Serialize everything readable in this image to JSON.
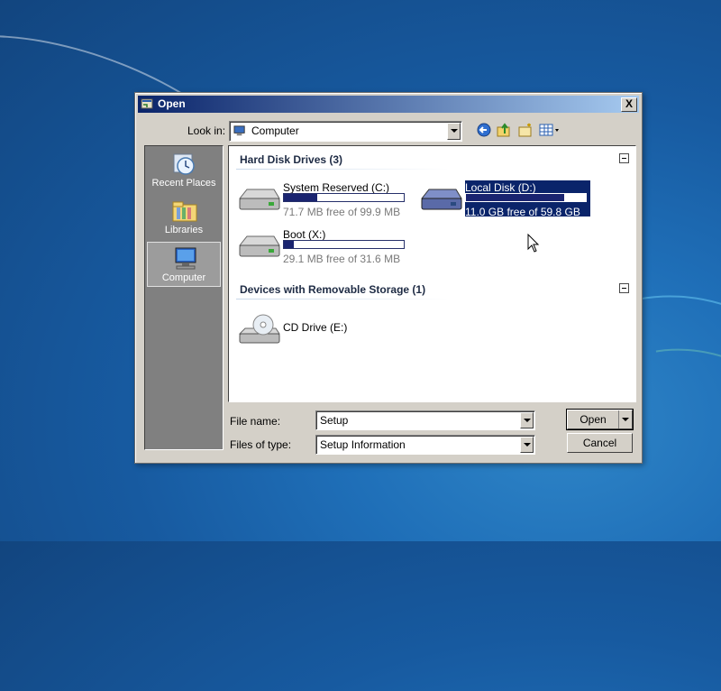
{
  "dialog": {
    "title": "Open",
    "close_label": "X"
  },
  "look_in": {
    "label": "Look in:",
    "value": "Computer"
  },
  "places": [
    {
      "label": "Recent Places",
      "icon": "recent-places-icon"
    },
    {
      "label": "Libraries",
      "icon": "libraries-icon"
    },
    {
      "label": "Computer",
      "icon": "computer-icon",
      "selected": true
    }
  ],
  "groups": {
    "hard_disks": {
      "header": "Hard Disk Drives (3)",
      "drives": [
        {
          "name": "System Reserved (C:)",
          "free": "71.7 MB free of 99.9 MB",
          "used_fraction": 0.28
        },
        {
          "name": "Local Disk (D:)",
          "free": "11.0 GB free of 59.8 GB",
          "used_fraction": 0.82,
          "selected": true
        },
        {
          "name": "Boot (X:)",
          "free": "29.1 MB free of 31.6 MB",
          "used_fraction": 0.08
        }
      ]
    },
    "removable": {
      "header": "Devices with Removable Storage (1)",
      "drives": [
        {
          "name": "CD Drive (E:)"
        }
      ]
    }
  },
  "file_name": {
    "label": "File name:",
    "value": "Setup"
  },
  "file_type": {
    "label": "Files of type:",
    "value": "Setup Information"
  },
  "buttons": {
    "open": "Open",
    "cancel": "Cancel"
  },
  "colors": {
    "titlebar_start": "#0a246a",
    "titlebar_end": "#a6caf0",
    "selection": "#0a246a",
    "usage_bar": "#1a2470",
    "desktop": "#1f6fb8"
  }
}
